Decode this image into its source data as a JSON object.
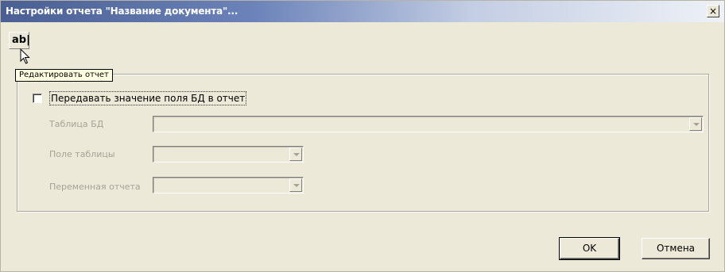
{
  "window": {
    "title": "Настройки отчета \"Название документа\"...",
    "close_label": "×"
  },
  "toolbar": {
    "edit_button_label": "ab|",
    "tooltip": "Редактировать отчет"
  },
  "form": {
    "checkbox_label": "Передавать значение поля БД в отчет",
    "checkbox_checked": false,
    "table_label": "Таблица БД",
    "table_value": "",
    "field_label": "Поле таблицы",
    "field_value": "",
    "variable_label": "Переменная отчета",
    "variable_value": ""
  },
  "buttons": {
    "ok": "OK",
    "cancel": "Отмена"
  }
}
